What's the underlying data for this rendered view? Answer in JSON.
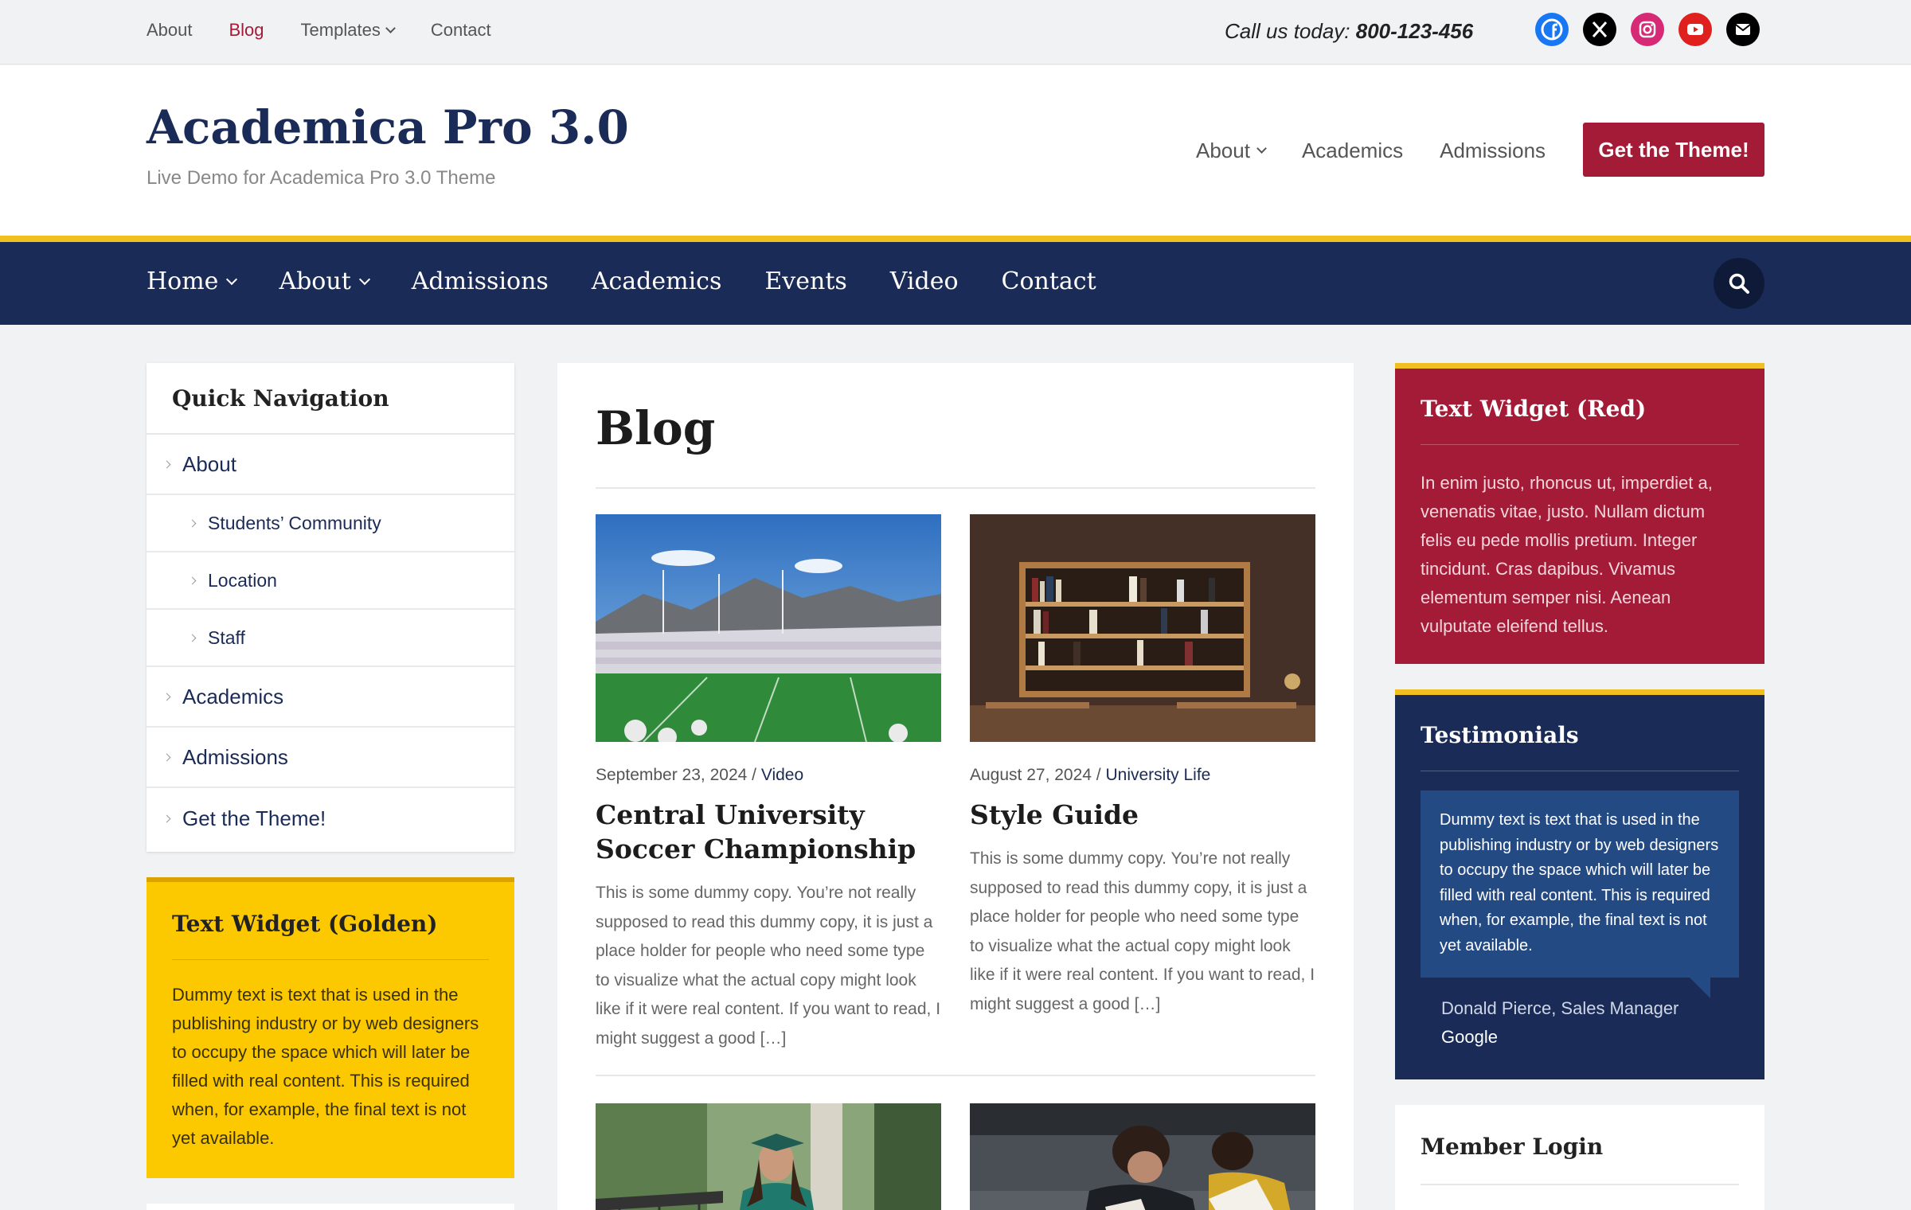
{
  "topbar": {
    "nav": [
      {
        "label": "About"
      },
      {
        "label": "Blog",
        "active": true
      },
      {
        "label": "Templates",
        "dropdown": true
      },
      {
        "label": "Contact"
      }
    ],
    "call_label": "Call us today:",
    "phone": "800-123-456",
    "social": [
      "facebook-icon",
      "x-icon",
      "instagram-icon",
      "youtube-icon",
      "mail-icon"
    ]
  },
  "header": {
    "title": "Academica Pro 3.0",
    "tagline": "Live Demo for Academica Pro 3.0 Theme",
    "nav": [
      {
        "label": "About",
        "dropdown": true
      },
      {
        "label": "Academics"
      },
      {
        "label": "Admissions"
      }
    ],
    "cta": "Get the Theme!"
  },
  "mainnav": {
    "items": [
      {
        "label": "Home",
        "dropdown": true
      },
      {
        "label": "About",
        "dropdown": true
      },
      {
        "label": "Admissions"
      },
      {
        "label": "Academics"
      },
      {
        "label": "Events"
      },
      {
        "label": "Video"
      },
      {
        "label": "Contact"
      }
    ]
  },
  "quicknav": {
    "title": "Quick Navigation",
    "items": [
      {
        "label": "About",
        "level": 1
      },
      {
        "label": "Students’ Community",
        "level": 2
      },
      {
        "label": "Location",
        "level": 2
      },
      {
        "label": "Staff",
        "level": 2
      },
      {
        "label": "Academics",
        "level": 1
      },
      {
        "label": "Admissions",
        "level": 1
      },
      {
        "label": "Get the Theme!",
        "level": 1
      }
    ]
  },
  "golden_widget": {
    "title": "Text Widget (Golden)",
    "text": "Dummy text is text that is used in the publishing industry or by web designers to occupy the space which will later be filled with real content. This is required when, for example, the final text is not yet available."
  },
  "blog": {
    "title": "Blog",
    "posts": [
      {
        "date": "September 23, 2024",
        "category": "Video",
        "title": "Central University Soccer Championship",
        "excerpt": "This is some dummy copy. You’re not really supposed to read this dummy copy, it is just a place holder for people who need some type to visualize what the actual copy might look like if it were real content. If you want to read, I might suggest a good […]"
      },
      {
        "date": "August 27, 2024",
        "category": "University Life",
        "title": "Style Guide",
        "excerpt": "This is some dummy copy. You’re not really supposed to read this dummy copy, it is just a place holder for people who need some type to visualize what the actual copy might look like if it were real content. If you want to read, I might suggest a good […]"
      }
    ],
    "meta_separator": " / "
  },
  "red_widget": {
    "title": "Text Widget (Red)",
    "text": "In enim justo, rhoncus ut, imperdiet a, venenatis vitae, justo. Nullam dictum felis eu pede mollis pretium. Integer tincidunt. Cras dapibus. Vivamus elementum semper nisi. Aenean vulputate eleifend tellus."
  },
  "testimonials": {
    "title": "Testimonials",
    "quote": "Dummy text is text that is used in the publishing industry or by web designers to occupy the space which will later be filled with real content. This is required when, for example, the final text is not yet available.",
    "author": "Donald Pierce, Sales Manager",
    "company": "Google"
  },
  "member_login": {
    "title": "Member Login"
  },
  "colors": {
    "navy": "#1a2b57",
    "crimson": "#a31b36",
    "gold": "#f0c020",
    "golden_widget": "#fcc800"
  }
}
